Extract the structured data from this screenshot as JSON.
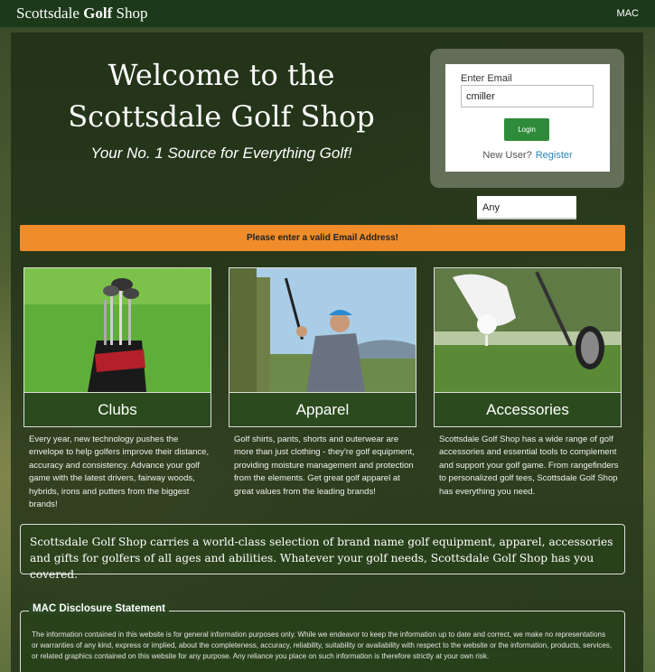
{
  "navbar": {
    "brand_prefix": "Scottsdale",
    "brand_bold": "Golf",
    "brand_suffix": "Shop",
    "right_label": "MAC"
  },
  "hero": {
    "title": "Welcome to the Scottsdale Golf Shop",
    "subtitle": "Your No. 1 Source for Everything Golf!"
  },
  "login": {
    "label": "Enter Email",
    "value": "cmiller",
    "button": "Login",
    "new_user": "New User?",
    "register": "Register"
  },
  "select": {
    "value": "Any"
  },
  "alert": "Please enter a valid Email Address!",
  "cards": [
    {
      "title": "Clubs",
      "description": "Every year, new technology pushes the envelope to help golfers improve their distance, accuracy and consistency. Advance your golf game with the latest drivers, fairway woods, hybrids, irons and putters from the biggest brands!"
    },
    {
      "title": "Apparel",
      "description": "Golf shirts, pants, shorts and outerwear are more than just clothing - they're golf equipment, providing moisture management and protection from the elements. Get great golf apparel at great values from the leading brands!"
    },
    {
      "title": "Accessories",
      "description": "Scottsdale Golf Shop has a wide range of golf accessories and essential tools to complement and support your golf game. From rangefinders to personalized golf tees, Scottsdale Golf Shop has everything you need."
    }
  ],
  "about": "Scottsdale Golf Shop carries a world-class selection of brand name golf equipment, apparel, accessories and gifts for golfers of all ages and abilities. Whatever your golf needs, Scottsdale Golf Shop has you covered.",
  "disclosure": {
    "title": "MAC Disclosure Statement",
    "text": "The information contained in this website is for general information purposes only. While we endeavor to keep the information up to date and correct, we make no representations or warranties of any kind, express or implied, about the completeness, accuracy, reliability, suitability or availability with respect to the website or the information, products, services, or related graphics contained on this website for any purpose. Any reliance you place on such information is therefore strictly at your own risk."
  }
}
